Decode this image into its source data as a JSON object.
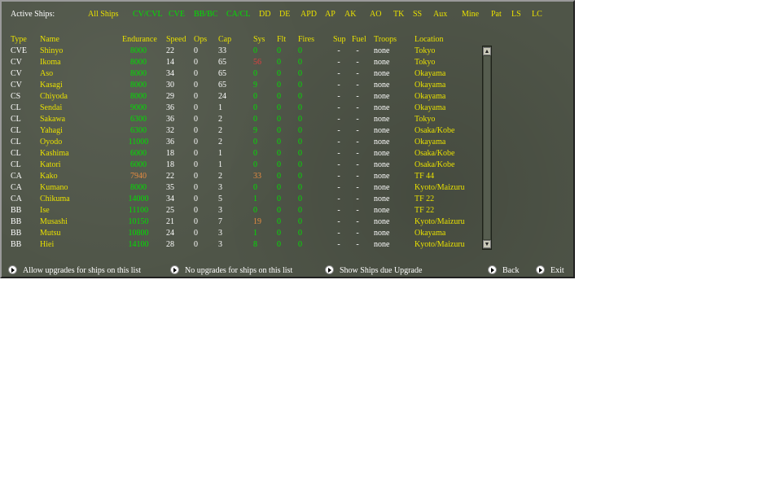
{
  "title": "Active Ships:",
  "filters": [
    {
      "label": "All Ships",
      "color": "#e8e000"
    },
    {
      "label": "CV/CVL",
      "color": "#00e000"
    },
    {
      "label": "CVE",
      "color": "#00e000"
    },
    {
      "label": "BB/BC",
      "color": "#00e000"
    },
    {
      "label": "CA/CL",
      "color": "#00e000"
    },
    {
      "label": "DD",
      "color": "#e8e000"
    },
    {
      "label": "DE",
      "color": "#e8e000"
    },
    {
      "label": "APD",
      "color": "#e8e000"
    },
    {
      "label": "AP",
      "color": "#e8e000"
    },
    {
      "label": "AK",
      "color": "#e8e000"
    },
    {
      "label": "AO",
      "color": "#e8e000"
    },
    {
      "label": "TK",
      "color": "#e8e000"
    },
    {
      "label": "SS",
      "color": "#e8e000"
    },
    {
      "label": "Aux",
      "color": "#e8e000"
    },
    {
      "label": "Mine",
      "color": "#e8e000"
    },
    {
      "label": "Pat",
      "color": "#e8e000"
    },
    {
      "label": "LS",
      "color": "#e8e000"
    },
    {
      "label": "LC",
      "color": "#e8e000"
    }
  ],
  "columns": [
    "Type",
    "Name",
    "Endurance",
    "Speed",
    "Ops",
    "Cap",
    "Sys",
    "Flt",
    "Fires",
    "Sup",
    "Fuel",
    "Troops",
    "Location"
  ],
  "ships": [
    {
      "type": "CVE",
      "name": "Shinyo",
      "endurance": "8000",
      "speed": "22",
      "ops": "0",
      "cap": "33",
      "sys": "0",
      "sys_color": "green",
      "flt": "0",
      "fires": "0",
      "sup": "-",
      "fuel": "-",
      "troops": "none",
      "location": "Tokyo"
    },
    {
      "type": "CV",
      "name": "Ikoma",
      "endurance": "8000",
      "speed": "14",
      "ops": "0",
      "cap": "65",
      "sys": "56",
      "sys_color": "red",
      "flt": "0",
      "fires": "0",
      "sup": "-",
      "fuel": "-",
      "troops": "none",
      "location": "Tokyo"
    },
    {
      "type": "CV",
      "name": "Aso",
      "endurance": "8000",
      "speed": "34",
      "ops": "0",
      "cap": "65",
      "sys": "0",
      "sys_color": "green",
      "flt": "0",
      "fires": "0",
      "sup": "-",
      "fuel": "-",
      "troops": "none",
      "location": "Okayama"
    },
    {
      "type": "CV",
      "name": "Kasagi",
      "endurance": "8000",
      "speed": "30",
      "ops": "0",
      "cap": "65",
      "sys": "9",
      "sys_color": "green",
      "flt": "0",
      "fires": "0",
      "sup": "-",
      "fuel": "-",
      "troops": "none",
      "location": "Okayama"
    },
    {
      "type": "CS",
      "name": "Chiyoda",
      "endurance": "8000",
      "speed": "29",
      "ops": "0",
      "cap": "24",
      "sys": "0",
      "sys_color": "green",
      "flt": "0",
      "fires": "0",
      "sup": "-",
      "fuel": "-",
      "troops": "none",
      "location": "Okayama"
    },
    {
      "type": "CL",
      "name": "Sendai",
      "endurance": "9000",
      "speed": "36",
      "ops": "0",
      "cap": "1",
      "sys": "0",
      "sys_color": "green",
      "flt": "0",
      "fires": "0",
      "sup": "-",
      "fuel": "-",
      "troops": "none",
      "location": "Okayama"
    },
    {
      "type": "CL",
      "name": "Sakawa",
      "endurance": "6300",
      "speed": "36",
      "ops": "0",
      "cap": "2",
      "sys": "0",
      "sys_color": "green",
      "flt": "0",
      "fires": "0",
      "sup": "-",
      "fuel": "-",
      "troops": "none",
      "location": "Tokyo"
    },
    {
      "type": "CL",
      "name": "Yahagi",
      "endurance": "6300",
      "speed": "32",
      "ops": "0",
      "cap": "2",
      "sys": "9",
      "sys_color": "green",
      "flt": "0",
      "fires": "0",
      "sup": "-",
      "fuel": "-",
      "troops": "none",
      "location": "Osaka/Kobe"
    },
    {
      "type": "CL",
      "name": "Oyodo",
      "endurance": "11000",
      "speed": "36",
      "ops": "0",
      "cap": "2",
      "sys": "0",
      "sys_color": "green",
      "flt": "0",
      "fires": "0",
      "sup": "-",
      "fuel": "-",
      "troops": "none",
      "location": "Okayama"
    },
    {
      "type": "CL",
      "name": "Kashima",
      "endurance": "6000",
      "speed": "18",
      "ops": "0",
      "cap": "1",
      "sys": "0",
      "sys_color": "green",
      "flt": "0",
      "fires": "0",
      "sup": "-",
      "fuel": "-",
      "troops": "none",
      "location": "Osaka/Kobe"
    },
    {
      "type": "CL",
      "name": "Katori",
      "endurance": "6000",
      "speed": "18",
      "ops": "0",
      "cap": "1",
      "sys": "0",
      "sys_color": "green",
      "flt": "0",
      "fires": "0",
      "sup": "-",
      "fuel": "-",
      "troops": "none",
      "location": "Osaka/Kobe"
    },
    {
      "type": "CA",
      "name": "Kako",
      "endurance": "7940",
      "endurance_color": "orange",
      "speed": "22",
      "ops": "0",
      "cap": "2",
      "sys": "33",
      "sys_color": "orange",
      "flt": "0",
      "fires": "0",
      "sup": "-",
      "fuel": "-",
      "troops": "none",
      "location": "TF 44"
    },
    {
      "type": "CA",
      "name": "Kumano",
      "endurance": "8000",
      "speed": "35",
      "ops": "0",
      "cap": "3",
      "sys": "0",
      "sys_color": "green",
      "flt": "0",
      "fires": "0",
      "sup": "-",
      "fuel": "-",
      "troops": "none",
      "location": "Kyoto/Maizuru"
    },
    {
      "type": "CA",
      "name": "Chikuma",
      "endurance": "14000",
      "speed": "34",
      "ops": "0",
      "cap": "5",
      "sys": "1",
      "sys_color": "green",
      "flt": "0",
      "fires": "0",
      "sup": "-",
      "fuel": "-",
      "troops": "none",
      "location": "TF 22"
    },
    {
      "type": "BB",
      "name": "Ise",
      "endurance": "11100",
      "speed": "25",
      "ops": "0",
      "cap": "3",
      "sys": "0",
      "sys_color": "green",
      "flt": "0",
      "fires": "0",
      "sup": "-",
      "fuel": "-",
      "troops": "none",
      "location": "TF 22"
    },
    {
      "type": "BB",
      "name": "Musashi",
      "endurance": "10150",
      "speed": "21",
      "ops": "0",
      "cap": "7",
      "sys": "19",
      "sys_color": "orange",
      "flt": "0",
      "fires": "0",
      "sup": "-",
      "fuel": "-",
      "troops": "none",
      "location": "Kyoto/Maizuru"
    },
    {
      "type": "BB",
      "name": "Mutsu",
      "endurance": "10800",
      "speed": "24",
      "ops": "0",
      "cap": "3",
      "sys": "1",
      "sys_color": "green",
      "flt": "0",
      "fires": "0",
      "sup": "-",
      "fuel": "-",
      "troops": "none",
      "location": "Okayama"
    },
    {
      "type": "BB",
      "name": "Hiei",
      "endurance": "14100",
      "speed": "28",
      "ops": "0",
      "cap": "3",
      "sys": "8",
      "sys_color": "green",
      "flt": "0",
      "fires": "0",
      "sup": "-",
      "fuel": "-",
      "troops": "none",
      "location": "Kyoto/Maizuru"
    }
  ],
  "scroll": {
    "up": "▲",
    "down": "▼"
  },
  "buttons": {
    "allow_upgrades": "Allow upgrades for ships on this list",
    "no_upgrades": "No upgrades for ships on this list",
    "show_due": "Show Ships due Upgrade",
    "back": "Back",
    "exit": "Exit"
  }
}
